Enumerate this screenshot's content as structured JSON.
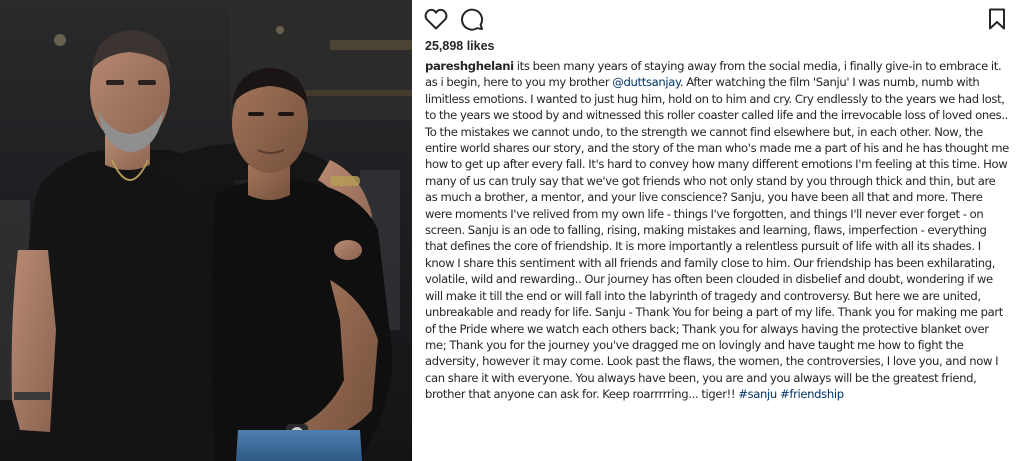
{
  "post": {
    "username": "pareshghelani",
    "likes": "25,898 likes",
    "caption": {
      "part1": "its been many years of staying away from the social media, i finally give-in to embrace it. as i begin, here to you my brother",
      "mention": "@duttsanjay",
      "part2": ". After watching the film 'Sanju' I was numb, numb with limitless emotions. I wanted to just hug him, hold on to him and cry. Cry endlessly to the years we had lost, to the years we stood by and witnessed this roller coaster called life and the irrevocable loss of loved ones.. To the mistakes we cannot undo, to the strength we cannot find elsewhere but, in each other. Now, the entire world shares our story, and the story of the man who's made me a part of his and he has thought me how to get up after every fall. It's hard to convey how many different emotions I'm feeling at this time. How many of us can truly say that we've got friends who not only stand by you through thick and thin, but are as much a brother, a mentor, and your live conscience? Sanju, you have been all that and more. There were moments I've relived from my own life - things I've forgotten, and things I'll never ever forget - on screen. Sanju is an ode to falling, rising, making mistakes and learning, flaws, imperfection - everything that defines the core of friendship. It is more importantly a relentless pursuit of life with all its shades. I know I share this sentiment with all friends and family close to him. Our friendship has been exhilarating, volatile, wild and rewarding.. Our journey has often been clouded in disbelief and doubt, wondering if we will make it till the end or will fall into the labyrinth of tragedy and controversy. But here we are united, unbreakable and ready for life. Sanju - Thank You for being a part of my life. Thank you for making me part of the Pride where we watch each others back; Thank you for always having the protective blanket over me; Thank you for the journey you've dragged me on lovingly and have taught me how to fight the adversity, however it may come. Look past the flaws, the women, the controversies, I love you, and now I can share it with everyone. You always have been, you are and you always will be the greatest friend, brother that anyone can ask for. Keep roarrrrring... tiger!!",
      "hashtags": [
        "#sanju",
        "#friendship"
      ]
    }
  },
  "icons": {
    "like": "heart-icon",
    "comment": "comment-icon",
    "save": "bookmark-icon"
  },
  "colors": {
    "text": "#262626",
    "link": "#003569",
    "photo_bg": "#1b1c1e"
  }
}
